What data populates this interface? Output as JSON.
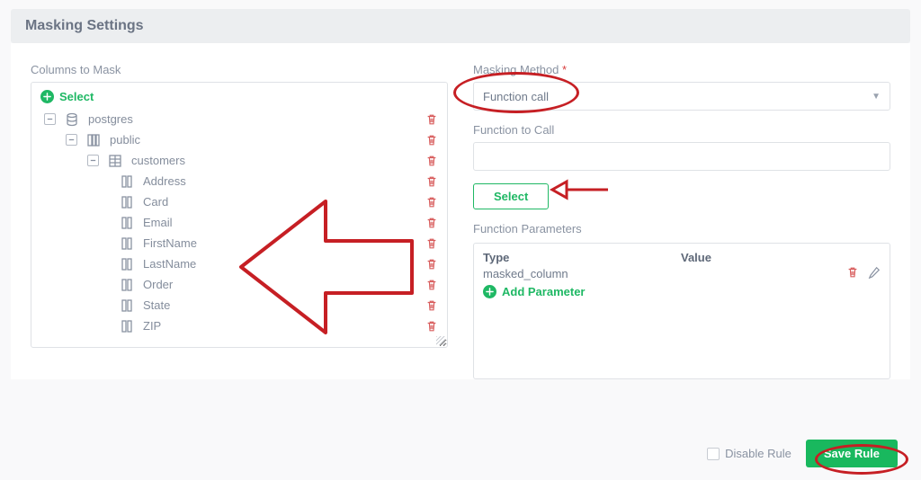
{
  "header": {
    "title": "Masking Settings"
  },
  "left": {
    "section_label": "Columns to Mask",
    "select_label": "Select",
    "tree": {
      "db": "postgres",
      "schema": "public",
      "table": "customers",
      "columns": [
        "Address",
        "Card",
        "Email",
        "FirstName",
        "LastName",
        "Order",
        "State",
        "ZIP"
      ]
    }
  },
  "right": {
    "method_label": "Masking Method",
    "method_value": "Function call",
    "func_label": "Function to Call",
    "func_value": "",
    "select_btn": "Select",
    "params_label": "Function Parameters",
    "params_header": {
      "type": "Type",
      "value": "Value"
    },
    "params_row": {
      "type": "masked_column",
      "value": ""
    },
    "add_param_label": "Add Parameter"
  },
  "footer": {
    "disable_label": "Disable Rule",
    "save_label": "Save Rule"
  }
}
